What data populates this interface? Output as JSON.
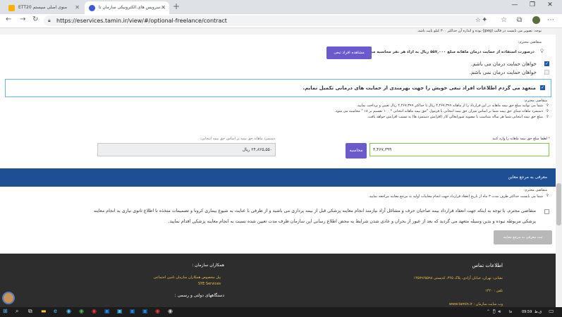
{
  "browser": {
    "tabs": [
      {
        "title": "ETT20 منوی اصلی سیستم"
      },
      {
        "title": "سرویس های الکترونیکی سازمان تا..."
      }
    ],
    "url": "https://eservices.tamin.ir/view/#/optional-freelance/contract"
  },
  "page": {
    "top_note": "توجه: تصویر می بایست در قالب (jpeg) بوده و اندازه آن حداکثر ۳۰۰ کیلو بایت باشد.",
    "applicant_label_1": "متقاضی محترم:",
    "support_info": "درصورت استفاده از حمایت درمان ماهانه مبلغ ۵۵۷,۰۰۰ ریال به ازاء هر نفر محاسبه می گردد.",
    "view_dependents_button": "مشاهده افراد تبعی",
    "option_want": "خواهان حمایت درمان می باشم.",
    "option_not_want": "خواهان حمایت درمان نمی باشم.",
    "commitment": "متعهد می گردم اطلاعات افراد تبعی خویش را جهت بهرمندی از حمایت های درمانی تکمیل نمایم.",
    "applicant_label_2": "متقاضی محترم:",
    "info_lines": [
      "شما می توانید مبلغ حق بیمه ماهانه در این قرارداد را از ماهانه ۴,۴۶۷,۳۹۹ ریال تا حداکثر ۴,۴۶۷,۳۹۹ ریال تعیین و پرداخت نمایید.",
      "دستمزد ماهانه مبنای حق بیمه شما بر اساس میزان حق بیمه انتخابی با فرمول \"حق بیمه ماهانه انتخابی * ۱۰۰ تقسیم بر ۱۸ \" محاسبه می شود.",
      "مبلغ حق بیمه انتخابی شما هر ساله متناسب با مصوبه شورایعالی کار (افزایش دستمزد ها) به نسبت افزایش خواهد یافت."
    ],
    "amount_label": "لطفا مبلغ حق بیمه ماهانه را وارد کنید",
    "amount_value": "۴,۴۶۷,۳۹۹",
    "calculate_button": "محاسبه",
    "wage_label": "دستمزد ماهانه حق بیمه بر اساس حق بیمه انتخابی:",
    "wage_value": "۲۴,۸۲۵,۵۵۰ ریال",
    "section_title": "معرفی به مرجع معاین",
    "applicant_label_3": "متقاضی محترم:",
    "referral_info": "شما می بایست حداکثر ظرف مدت ۳ ماه از تاریخ انعقاد قرارداد جهت انجام معاینات اولیه به مرجع معاینه مراجعه نمایید.",
    "referral_text_1": "متقاضی محترم، با توجه به اینکه جهت انعقاد قرارداد بیمه صاحبان حرف و مشاغل آزاد نیازمند انجام معاینه پزشکی قبل از بیمه پردازی می باشید و از طرفی با عنایت به شیوع بیماری کرونا و تصمیمات متخذه تا اطلاع ثانوی نیازی به انجام معاینه",
    "referral_text_2": "پزشکی مربوطه نبوده و بدین وسیله متعهد می گردید که بعد از عبور از بحران و عادی شدن شرایط به محض اطلاع رسانی این سازمان ظرف مدت تعیین شده نسبت به انجام معاینه پزشکی اقدام نمایید.",
    "referral_button": "ثبت معرفی به مرجع معاینه"
  },
  "footer": {
    "contact_title": "اطلاعات تماس",
    "address": "نشانی: تهران، خیابان آزادی، پلاک ۳۶۵، کدپستی ۱۴۵۷۹۶۵۵۹۸",
    "phone": "تلفن : ۱۴۲۰",
    "website": "وب سایت سازمان : www.tamin.ir",
    "partners_title": "همکاران سازمان :",
    "partner_1": "پیل مخصوص همکاران سازمان تامین اجتماعی",
    "partner_2": "SYE Services",
    "gov_title": "دستگاههای دولتی و رسمی :"
  },
  "taskbar": {
    "time": "09:59",
    "time_suffix": "ق.ظ",
    "lang": "فا"
  },
  "colors": {
    "accent": "#1e4f95",
    "button": "#6a5acd",
    "footer_bg": "#2d2d2d",
    "footer_text": "#f0c043"
  }
}
